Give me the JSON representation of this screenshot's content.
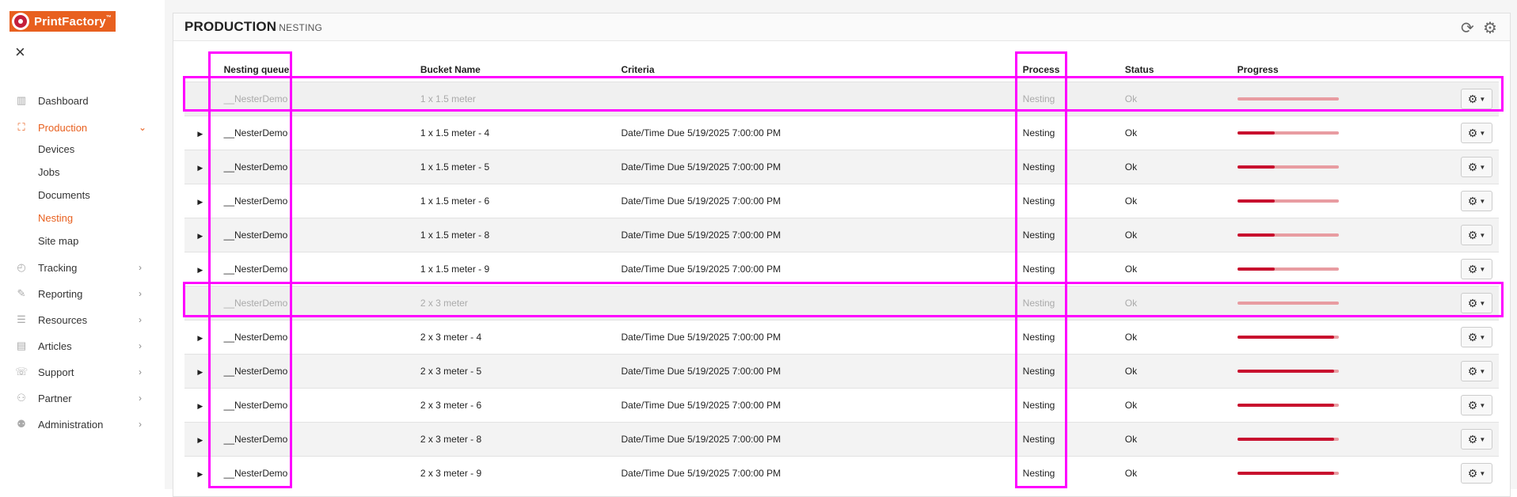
{
  "brand": {
    "name": "PrintFactory",
    "tm": "™"
  },
  "sidebar": {
    "items": [
      {
        "label": "Dashboard"
      },
      {
        "label": "Production",
        "chevron": "⌄"
      },
      {
        "label": "Tracking",
        "chevron": "›"
      },
      {
        "label": "Reporting",
        "chevron": "›"
      },
      {
        "label": "Resources",
        "chevron": "›"
      },
      {
        "label": "Articles",
        "chevron": "›"
      },
      {
        "label": "Support",
        "chevron": "›"
      },
      {
        "label": "Partner",
        "chevron": "›"
      },
      {
        "label": "Administration",
        "chevron": "›"
      }
    ],
    "production_sub": [
      "Devices",
      "Jobs",
      "Documents",
      "Nesting",
      "Site map"
    ]
  },
  "header": {
    "title": "PRODUCTION",
    "subtitle": "NESTING"
  },
  "table": {
    "columns": [
      "Nesting queue",
      "Bucket Name",
      "Criteria",
      "Process",
      "Status",
      "Progress"
    ],
    "rows": [
      {
        "queue": "__NesterDemo",
        "bucket": "1 x 1.5 meter",
        "criteria": "",
        "process": "Nesting",
        "status": "Ok",
        "progress": 1.0,
        "dim": true
      },
      {
        "queue": "__NesterDemo",
        "bucket": "1 x 1.5 meter - 4",
        "criteria": "Date/Time Due 5/19/2025 7:00:00 PM",
        "process": "Nesting",
        "status": "Ok",
        "progress": 0.37
      },
      {
        "queue": "__NesterDemo",
        "bucket": "1 x 1.5 meter - 5",
        "criteria": "Date/Time Due 5/19/2025 7:00:00 PM",
        "process": "Nesting",
        "status": "Ok",
        "progress": 0.37
      },
      {
        "queue": "__NesterDemo",
        "bucket": "1 x 1.5 meter - 6",
        "criteria": "Date/Time Due 5/19/2025 7:00:00 PM",
        "process": "Nesting",
        "status": "Ok",
        "progress": 0.37
      },
      {
        "queue": "__NesterDemo",
        "bucket": "1 x 1.5 meter - 8",
        "criteria": "Date/Time Due 5/19/2025 7:00:00 PM",
        "process": "Nesting",
        "status": "Ok",
        "progress": 0.37
      },
      {
        "queue": "__NesterDemo",
        "bucket": "1 x 1.5 meter - 9",
        "criteria": "Date/Time Due 5/19/2025 7:00:00 PM",
        "process": "Nesting",
        "status": "Ok",
        "progress": 0.37
      },
      {
        "queue": "__NesterDemo",
        "bucket": "2 x 3 meter",
        "criteria": "",
        "process": "Nesting",
        "status": "Ok",
        "progress": 1.0,
        "dim": true
      },
      {
        "queue": "__NesterDemo",
        "bucket": "2 x 3 meter - 4",
        "criteria": "Date/Time Due 5/19/2025 7:00:00 PM",
        "process": "Nesting",
        "status": "Ok",
        "progress": 0.95
      },
      {
        "queue": "__NesterDemo",
        "bucket": "2 x 3 meter - 5",
        "criteria": "Date/Time Due 5/19/2025 7:00:00 PM",
        "process": "Nesting",
        "status": "Ok",
        "progress": 0.95
      },
      {
        "queue": "__NesterDemo",
        "bucket": "2 x 3 meter - 6",
        "criteria": "Date/Time Due 5/19/2025 7:00:00 PM",
        "process": "Nesting",
        "status": "Ok",
        "progress": 0.95
      },
      {
        "queue": "__NesterDemo",
        "bucket": "2 x 3 meter - 8",
        "criteria": "Date/Time Due 5/19/2025 7:00:00 PM",
        "process": "Nesting",
        "status": "Ok",
        "progress": 0.95
      },
      {
        "queue": "__NesterDemo",
        "bucket": "2 x 3 meter - 9",
        "criteria": "Date/Time Due 5/19/2025 7:00:00 PM",
        "process": "Nesting",
        "status": "Ok",
        "progress": 0.95
      }
    ]
  },
  "colors": {
    "brand": "#e8601f",
    "progress_fill": "#c8102e",
    "progress_track": "#e89ca1",
    "highlight": "#ff00ff"
  }
}
